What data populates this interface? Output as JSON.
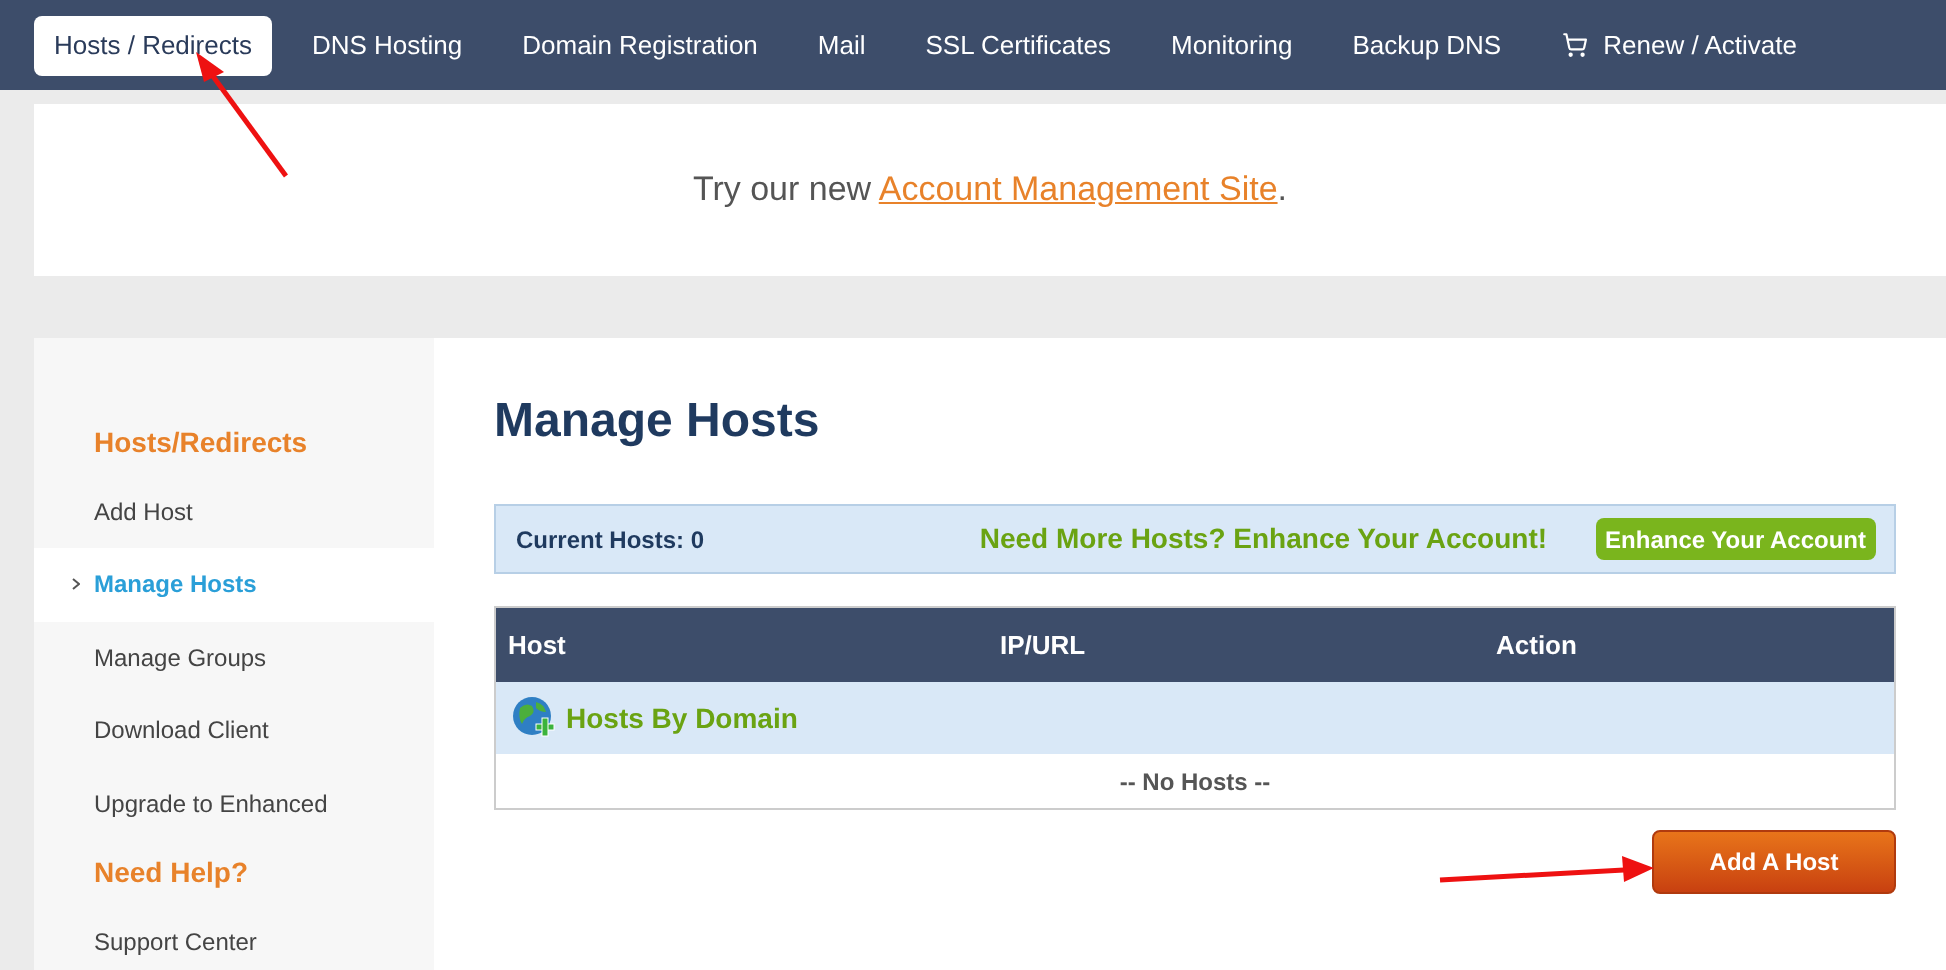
{
  "nav": [
    {
      "label": "Hosts / Redirects",
      "selected": true
    },
    {
      "label": "DNS Hosting",
      "selected": false
    },
    {
      "label": "Domain Registration",
      "selected": false
    },
    {
      "label": "Mail",
      "selected": false
    },
    {
      "label": "SSL Certificates",
      "selected": false
    },
    {
      "label": "Monitoring",
      "selected": false
    },
    {
      "label": "Backup DNS",
      "selected": false
    },
    {
      "label": "Renew / Activate",
      "selected": false,
      "kind": "cart"
    }
  ],
  "banner": {
    "text": "Try our new ",
    "link": "Account Management Site",
    "after": "."
  },
  "sidebar": [
    {
      "kind": "heading",
      "label": "Hosts/Redirects"
    },
    {
      "kind": "item",
      "label": "Add Host",
      "selected": false
    },
    {
      "kind": "item",
      "label": "Manage Hosts",
      "selected": true
    },
    {
      "kind": "item",
      "label": "Manage Groups",
      "selected": false
    },
    {
      "kind": "item",
      "label": "Download Client",
      "selected": false
    },
    {
      "kind": "item",
      "label": "Upgrade to Enhanced",
      "selected": false
    },
    {
      "kind": "heading",
      "label": "Need Help?"
    },
    {
      "kind": "item",
      "label": "Support Center",
      "selected": false
    }
  ],
  "page_title": "Manage Hosts",
  "info_bar": {
    "count": "Current Hosts: 0",
    "promo": "Need More Hosts? Enhance Your Account!",
    "button": "Enhance Your Account"
  },
  "table": {
    "columns": [
      "Host",
      "IP/URL",
      "Action"
    ],
    "group": "Hosts By Domain",
    "empty": "-- No Hosts --"
  },
  "add_button": "Add A Host"
}
